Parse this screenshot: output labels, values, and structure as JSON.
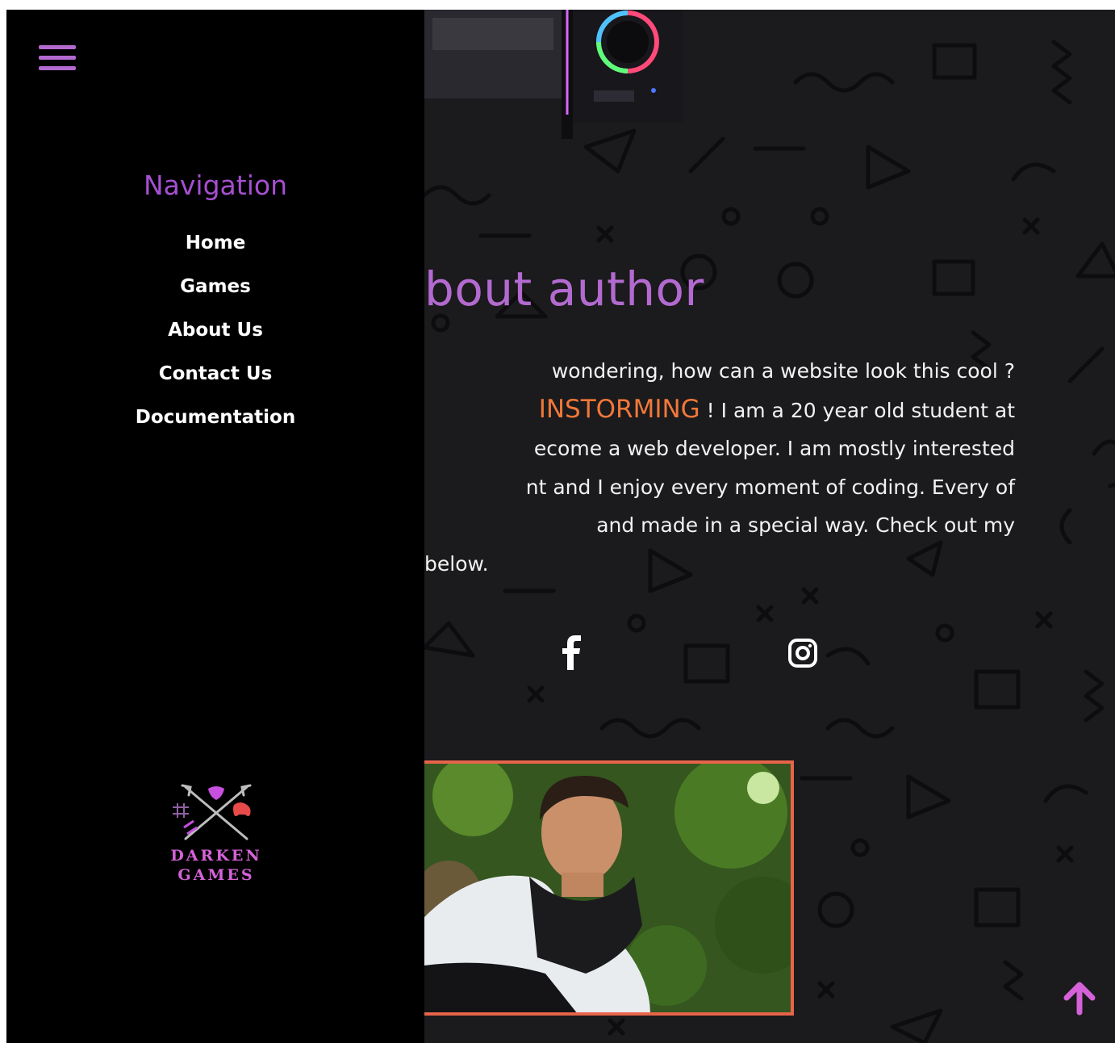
{
  "sidebar": {
    "menu_icon": "hamburger-menu-icon",
    "heading": "Navigation",
    "items": [
      {
        "label": "Home"
      },
      {
        "label": "Games"
      },
      {
        "label": "About Us"
      },
      {
        "label": "Contact Us"
      },
      {
        "label": "Documentation"
      }
    ],
    "logo": {
      "line1": "DARKEN",
      "line2": "GAMES",
      "icon": "crossed-arrows-gamepad-logo"
    }
  },
  "main": {
    "title": "bout author",
    "paragraph": {
      "line1": "wondering, how can a website look this cool ?",
      "line2_highlight": "INSTORMING",
      "line2_rest": " ! I am a 20 year old student at",
      "line3": "ecome a web developer. I am mostly interested",
      "line4": "nt and I enjoy every moment of coding. Every of",
      "line5": "and made in a special way. Check out my",
      "line6": "below."
    },
    "social": [
      {
        "icon": "facebook-icon"
      },
      {
        "icon": "instagram-icon"
      }
    ],
    "scroll_top_icon": "arrow-up-icon"
  },
  "colors": {
    "accent_purple": "#b36ad0",
    "nav_heading": "#a64fd1",
    "highlight_orange": "#f0783a",
    "photo_border": "#e8644a",
    "page_background": "#1b1a1c",
    "sidebar_background": "#000000"
  }
}
